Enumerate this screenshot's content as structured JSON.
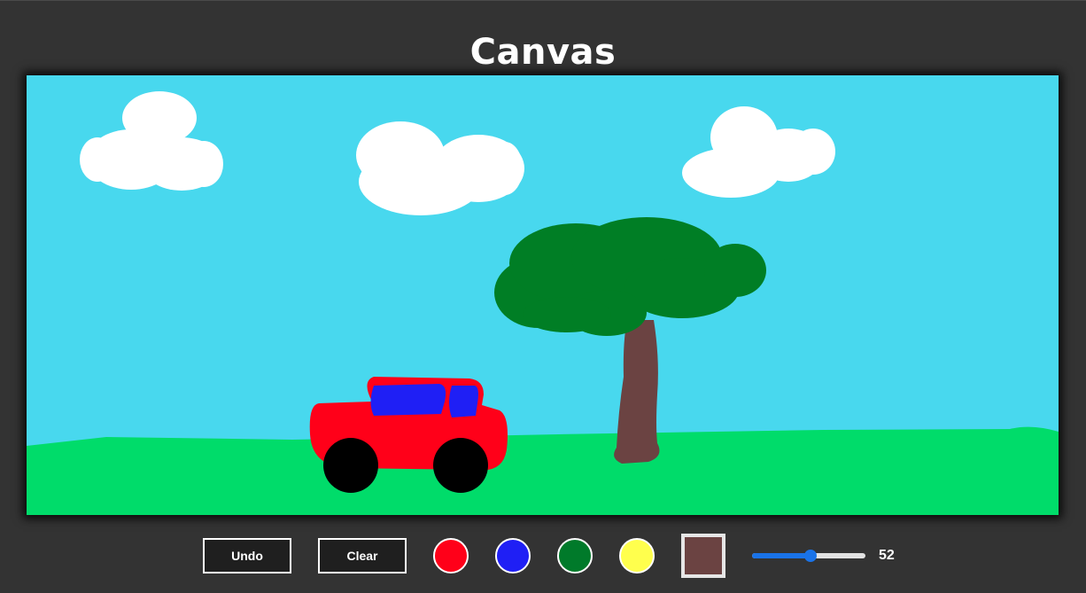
{
  "app": {
    "title": "Canvas"
  },
  "toolbar": {
    "undo_label": "Undo",
    "clear_label": "Clear",
    "colors": [
      "#ff0019",
      "#1f1ff5",
      "#007a2a",
      "#ffff4d"
    ],
    "current_color": "#6b4342",
    "brush_size": {
      "value": 52,
      "min": 1,
      "max": 100
    }
  },
  "drawing": {
    "sky_color": "#48d8ee",
    "grass_color": "#00dc6a",
    "cloud_color": "#ffffff",
    "tree_foliage_color": "#007e25",
    "tree_trunk_color": "#6b4342",
    "car_body_color": "#ff0019",
    "car_window_color": "#1f1ff5",
    "wheel_color": "#000000"
  }
}
